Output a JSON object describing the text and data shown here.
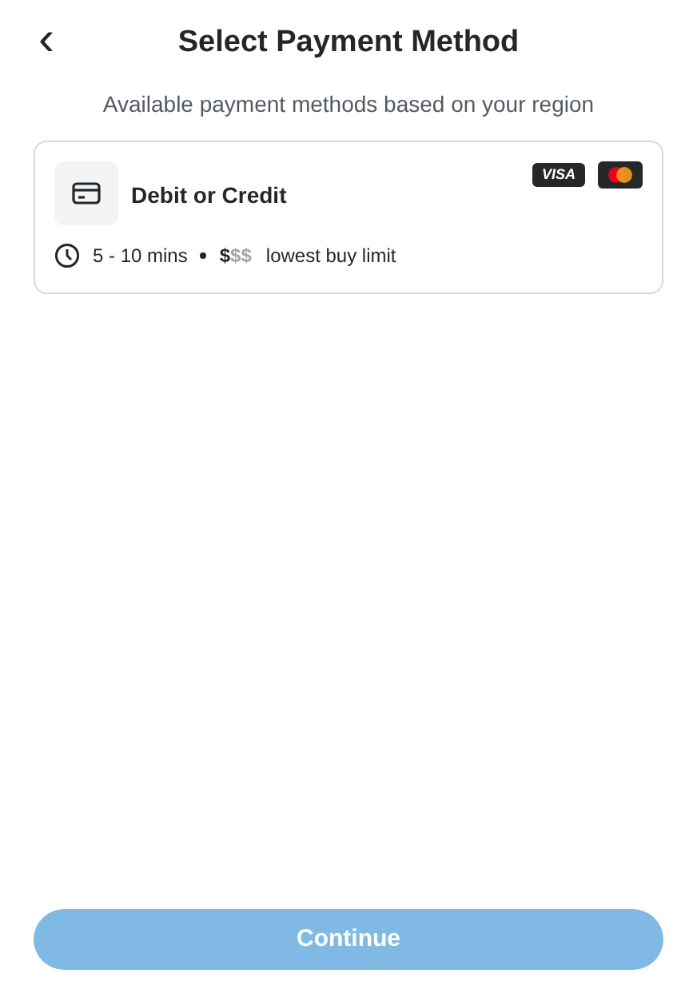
{
  "header": {
    "back": "‹",
    "title": "Select Payment Method"
  },
  "subtitle": "Available payment methods based on your region",
  "methods": [
    {
      "name": "Debit or Credit",
      "badges": [
        {
          "kind": "visa",
          "label": "VISA"
        },
        {
          "kind": "mastercard"
        }
      ],
      "time": "5 - 10 mins",
      "cost_active": "$",
      "cost_inactive": "$$",
      "limit": "lowest buy limit"
    }
  ],
  "continue": {
    "label": "Continue",
    "disabled": true
  }
}
